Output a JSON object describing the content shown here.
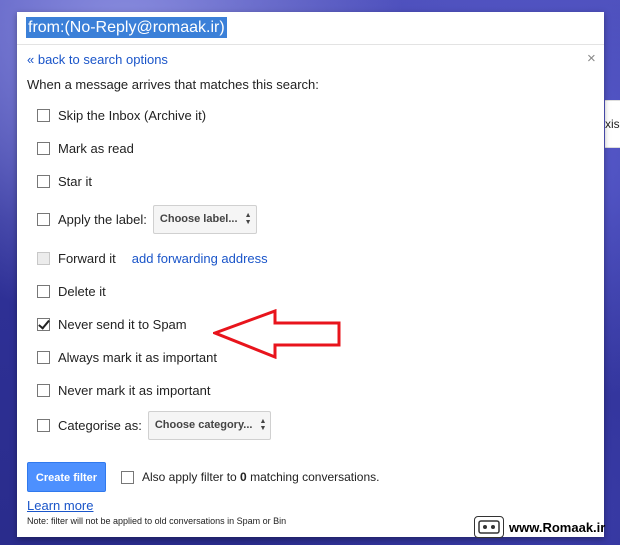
{
  "search": {
    "query": "from:(No-Reply@romaak.ir)"
  },
  "filter_panel": {
    "back_link": "« back to search options",
    "close_glyph": "×",
    "intro": "When a message arrives that matches this search:",
    "options": {
      "skip_inbox": "Skip the Inbox (Archive it)",
      "mark_read": "Mark as read",
      "star": "Star it",
      "apply_label": "Apply the label:",
      "label_select": "Choose label...",
      "forward": "Forward it",
      "forward_link": "add forwarding address",
      "delete": "Delete it",
      "never_spam": "Never send it to Spam",
      "always_important": "Always mark it as important",
      "never_important": "Never mark it as important",
      "categorise": "Categorise as:",
      "category_select": "Choose category..."
    },
    "checked_option": "never_spam",
    "disabled_option": "forward",
    "create_button": "Create filter",
    "also_apply_prefix": "Also apply filter to ",
    "also_apply_count": "0",
    "also_apply_suffix": " matching conversations.",
    "learn_more": "Learn more",
    "note": "Note: filter will not be applied to old conversations in Spam or Bin"
  },
  "background_strip_text": "xis",
  "watermark": {
    "text": "www.Romaak.ir"
  },
  "colors": {
    "primary_button": "#4d90fe",
    "link": "#1a55c9",
    "annotation_arrow": "#e8141c",
    "selection_highlight": "#3b80d8"
  }
}
